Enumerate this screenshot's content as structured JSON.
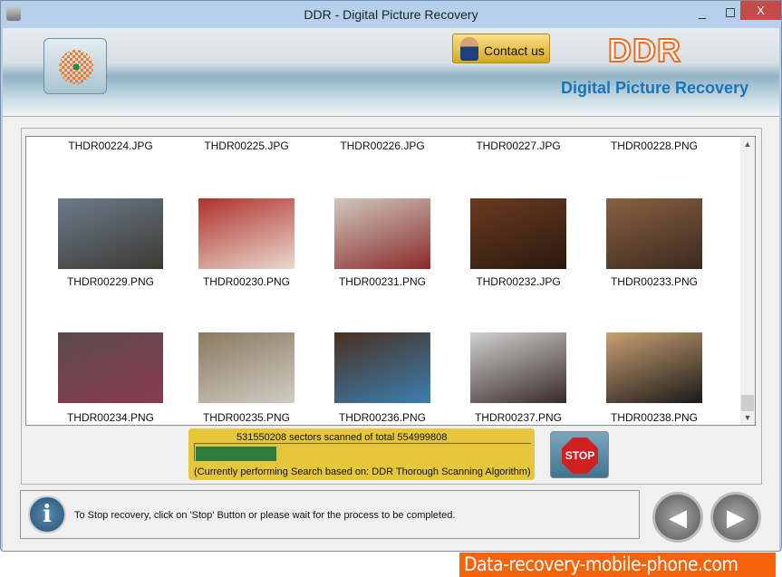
{
  "window": {
    "title": "DDR - Digital Picture Recovery",
    "minimize": "_",
    "close": "X"
  },
  "header": {
    "contact_label": "Contact us",
    "brand": "DDR",
    "subtitle": "Digital Picture Recovery"
  },
  "files": [
    {
      "name": "THDR00224.JPG",
      "thumb": false
    },
    {
      "name": "THDR00225.JPG",
      "thumb": false
    },
    {
      "name": "THDR00226.JPG",
      "thumb": false
    },
    {
      "name": "THDR00227.JPG",
      "thumb": false
    },
    {
      "name": "THDR00228.PNG",
      "thumb": false
    },
    {
      "name": "THDR00229.PNG",
      "thumb": true,
      "colors": [
        "#6a7b8a",
        "#3d3a33"
      ]
    },
    {
      "name": "THDR00230.PNG",
      "thumb": true,
      "colors": [
        "#b0302a",
        "#e9d9cf"
      ]
    },
    {
      "name": "THDR00231.PNG",
      "thumb": true,
      "colors": [
        "#cfc8bd",
        "#8a2a2a"
      ]
    },
    {
      "name": "THDR00232.JPG",
      "thumb": true,
      "colors": [
        "#6b3a1f",
        "#2a1a10"
      ]
    },
    {
      "name": "THDR00233.PNG",
      "thumb": true,
      "colors": [
        "#8a6040",
        "#3a2a20"
      ]
    },
    {
      "name": "THDR00234.PNG",
      "thumb": true,
      "colors": [
        "#5a4a4a",
        "#8a3a50"
      ]
    },
    {
      "name": "THDR00235.PNG",
      "thumb": true,
      "colors": [
        "#8a7a60",
        "#d0ccc4"
      ]
    },
    {
      "name": "THDR00236.PNG",
      "thumb": true,
      "colors": [
        "#4a3020",
        "#3a7fb0"
      ]
    },
    {
      "name": "THDR00237.PNG",
      "thumb": true,
      "colors": [
        "#d0d0d0",
        "#3a2a2a"
      ]
    },
    {
      "name": "THDR00238.PNG",
      "thumb": true,
      "colors": [
        "#c8a070",
        "#1a1a1a"
      ]
    }
  ],
  "scan": {
    "status": "531550208 sectors scanned of total 554999808",
    "progress_percent": 24,
    "algorithm": "(Currently performing Search based on:  DDR Thorough Scanning Algorithm)",
    "stop_label": "STOP"
  },
  "footer": {
    "message": "To Stop recovery, click on 'Stop' Button or please wait for the process to be completed.",
    "info_icon": "i",
    "back": "◀",
    "next": "▶"
  },
  "watermark": "Data-recovery-mobile-phone.com"
}
